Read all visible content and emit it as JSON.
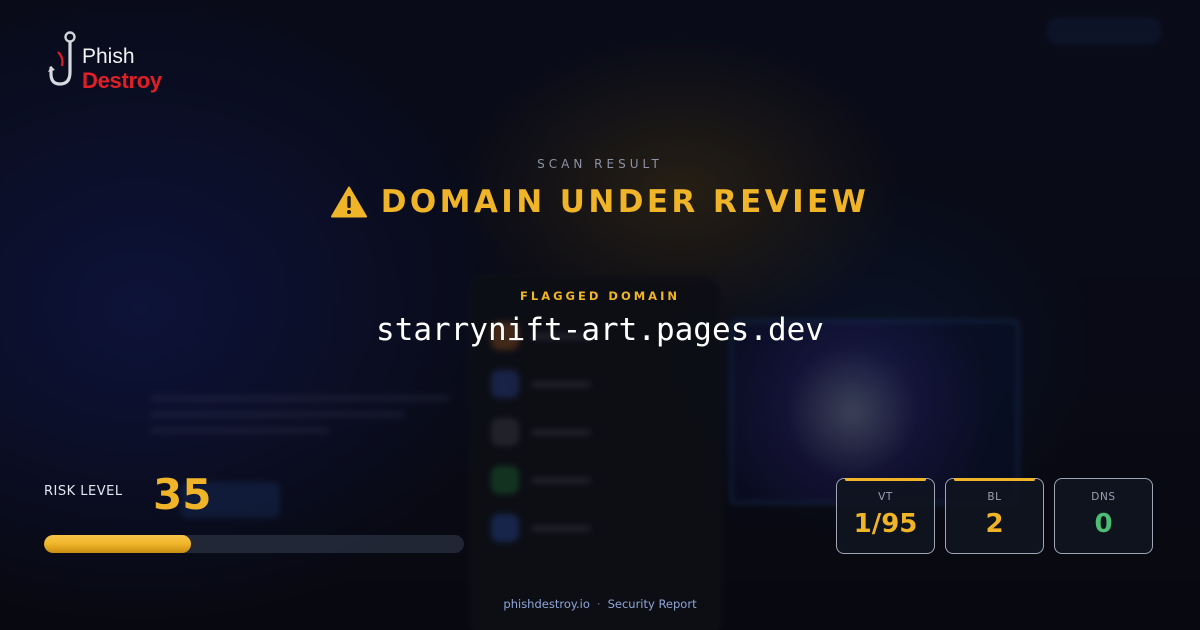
{
  "logo": {
    "line1": "Phish",
    "line2": "Destroy"
  },
  "scan": {
    "label": "SCAN RESULT",
    "title": "DOMAIN UNDER REVIEW",
    "icon": "warning-triangle-icon"
  },
  "flagged": {
    "label": "FLAGGED DOMAIN",
    "domain": "starrynift-art.pages.dev"
  },
  "risk": {
    "label": "RISK LEVEL",
    "value": "35",
    "level_percent": 35
  },
  "stats": [
    {
      "label": "VT",
      "value": "1/95",
      "color": "#f0b429"
    },
    {
      "label": "BL",
      "value": "2",
      "color": "#f0b429"
    },
    {
      "label": "DNS",
      "value": "0",
      "color": "#4ebd74"
    }
  ],
  "footer": {
    "site": "phishdestroy.io",
    "separator": "·",
    "report": "Security Report"
  },
  "colors": {
    "accent": "#f0b429",
    "brand_red": "#e01f26",
    "safe_green": "#4ebd74"
  }
}
